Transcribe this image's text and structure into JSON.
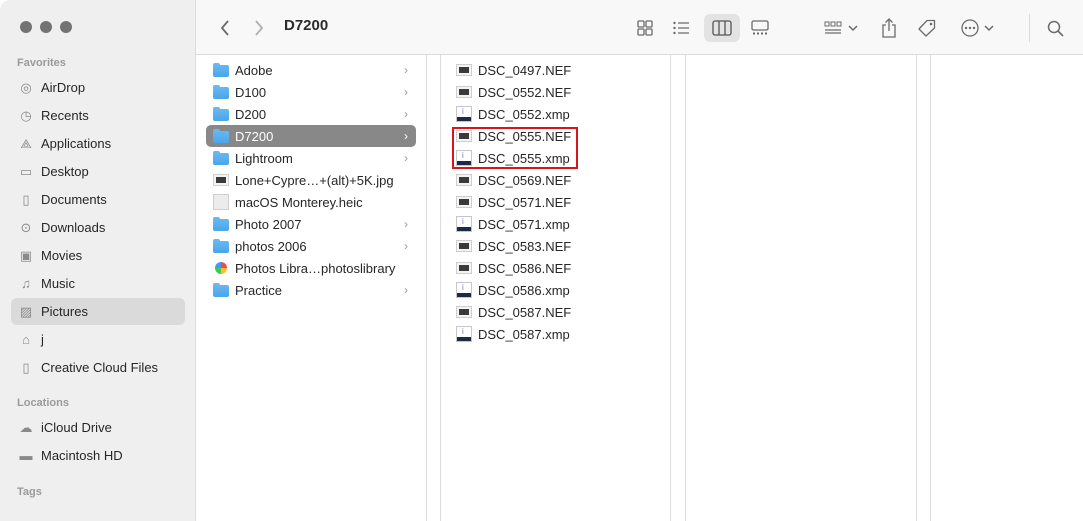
{
  "window": {
    "title": "D7200"
  },
  "sidebar": {
    "favorites_title": "Favorites",
    "favorites": [
      {
        "label": "AirDrop",
        "icon": "airdrop-icon"
      },
      {
        "label": "Recents",
        "icon": "clock-icon"
      },
      {
        "label": "Applications",
        "icon": "applications-icon"
      },
      {
        "label": "Desktop",
        "icon": "desktop-icon"
      },
      {
        "label": "Documents",
        "icon": "document-icon"
      },
      {
        "label": "Downloads",
        "icon": "download-icon"
      },
      {
        "label": "Movies",
        "icon": "film-icon"
      },
      {
        "label": "Music",
        "icon": "music-icon"
      },
      {
        "label": "Pictures",
        "icon": "photo-icon",
        "selected": true
      },
      {
        "label": "j",
        "icon": "home-icon"
      },
      {
        "label": "Creative Cloud Files",
        "icon": "file-icon"
      }
    ],
    "locations_title": "Locations",
    "locations": [
      {
        "label": "iCloud Drive",
        "icon": "cloud-icon"
      },
      {
        "label": "Macintosh HD",
        "icon": "disk-icon"
      }
    ],
    "tags_title": "Tags"
  },
  "column1": [
    {
      "label": "Adobe",
      "type": "folder"
    },
    {
      "label": "D100",
      "type": "folder"
    },
    {
      "label": "D200",
      "type": "folder"
    },
    {
      "label": "D7200",
      "type": "folder",
      "selected": true
    },
    {
      "label": "Lightroom",
      "type": "folder"
    },
    {
      "label": "Lone+Cypre…+(alt)+5K.jpg",
      "type": "image"
    },
    {
      "label": "macOS Monterey.heic",
      "type": "heic"
    },
    {
      "label": "Photo 2007",
      "type": "folder"
    },
    {
      "label": "photos 2006",
      "type": "folder"
    },
    {
      "label": "Photos Libra…photoslibrary",
      "type": "photos"
    },
    {
      "label": "Practice",
      "type": "folder"
    }
  ],
  "column2": [
    {
      "label": "DSC_0497.NEF",
      "type": "nef"
    },
    {
      "label": "DSC_0552.NEF",
      "type": "nef"
    },
    {
      "label": "DSC_0552.xmp",
      "type": "xmp"
    },
    {
      "label": "DSC_0555.NEF",
      "type": "nef"
    },
    {
      "label": "DSC_0555.xmp",
      "type": "xmp"
    },
    {
      "label": "DSC_0569.NEF",
      "type": "nef"
    },
    {
      "label": "DSC_0571.NEF",
      "type": "nef"
    },
    {
      "label": "DSC_0571.xmp",
      "type": "xmp"
    },
    {
      "label": "DSC_0583.NEF",
      "type": "nef"
    },
    {
      "label": "DSC_0586.NEF",
      "type": "nef"
    },
    {
      "label": "DSC_0586.xmp",
      "type": "xmp"
    },
    {
      "label": "DSC_0587.NEF",
      "type": "nef"
    },
    {
      "label": "DSC_0587.xmp",
      "type": "xmp"
    }
  ],
  "colors": {
    "highlight": "#d8141c",
    "folder": "#4aa5ea",
    "selected_row": "#888888"
  }
}
